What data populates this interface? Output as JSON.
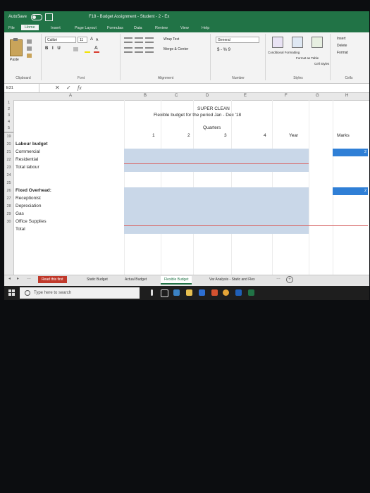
{
  "window": {
    "autosave": "AutoSave",
    "document_title": "F18 - Budget Assignment - Student - 2 - Ex"
  },
  "ribbon_tabs": [
    "File",
    "Home",
    "Insert",
    "Page Layout",
    "Formulas",
    "Data",
    "Review",
    "View",
    "Help"
  ],
  "ribbon": {
    "clipboard": {
      "paste": "Paste",
      "label": "Clipboard"
    },
    "font": {
      "name": "Calibri",
      "size": "11",
      "label": "Font"
    },
    "alignment": {
      "wrap": "Wrap Text",
      "merge": "Merge & Center",
      "label": "Alignment"
    },
    "number": {
      "format": "General",
      "symbols": "$ - % 9",
      "label": "Number"
    },
    "styles": {
      "conditional": "Conditional Formatting",
      "format_table": "Format as Table",
      "cell_styles": "Cell Styles",
      "label": "Styles"
    },
    "cells": {
      "insert": "Insert",
      "delete": "Delete",
      "format": "Format",
      "label": "Cells"
    }
  },
  "formula_bar": {
    "name_box": "E31",
    "cancel": "✕",
    "enter": "✓",
    "fx": "fx"
  },
  "columns": [
    "A",
    "B",
    "C",
    "D",
    "E",
    "F",
    "G",
    "H"
  ],
  "rows": {
    "top": [
      "1",
      "2",
      "3",
      "4",
      "5"
    ],
    "bottom": [
      "19",
      "20",
      "21",
      "22",
      "23",
      "24",
      "25",
      "26",
      "27",
      "28",
      "29",
      "30"
    ]
  },
  "sheet": {
    "company": "SUPER CLEAN",
    "subtitle": "Flexible budget for the period Jan - Dec '18",
    "quarters_label": "Quarters",
    "quarters": [
      "1",
      "2",
      "3",
      "4"
    ],
    "year": "Year",
    "marks": "Marks",
    "labour_budget": "Labour budget",
    "commercial": "Commercial",
    "residential": "Residential",
    "total_labour": "Total labour",
    "fixed_overhead": "Fixed Overhead:",
    "receptionist": "Receptionist",
    "depreciation": "Depreciation",
    "gas": "Gas",
    "office_supplies": "Office Supplies",
    "total": "Total",
    "mark_value_1": "2",
    "mark_value_2": "2"
  },
  "sheet_tabs": [
    "Read this first",
    "Static Budget",
    "Actual Budget",
    "Flexible Budget",
    "Var Analysis - Static and Flex"
  ],
  "taskbar": {
    "search_placeholder": "Type here to search"
  },
  "colors": {
    "excel_green": "#217346",
    "input_band": "#c9d7e8",
    "marks_blue": "#2f7fd6",
    "tab_red": "#c0392b"
  }
}
